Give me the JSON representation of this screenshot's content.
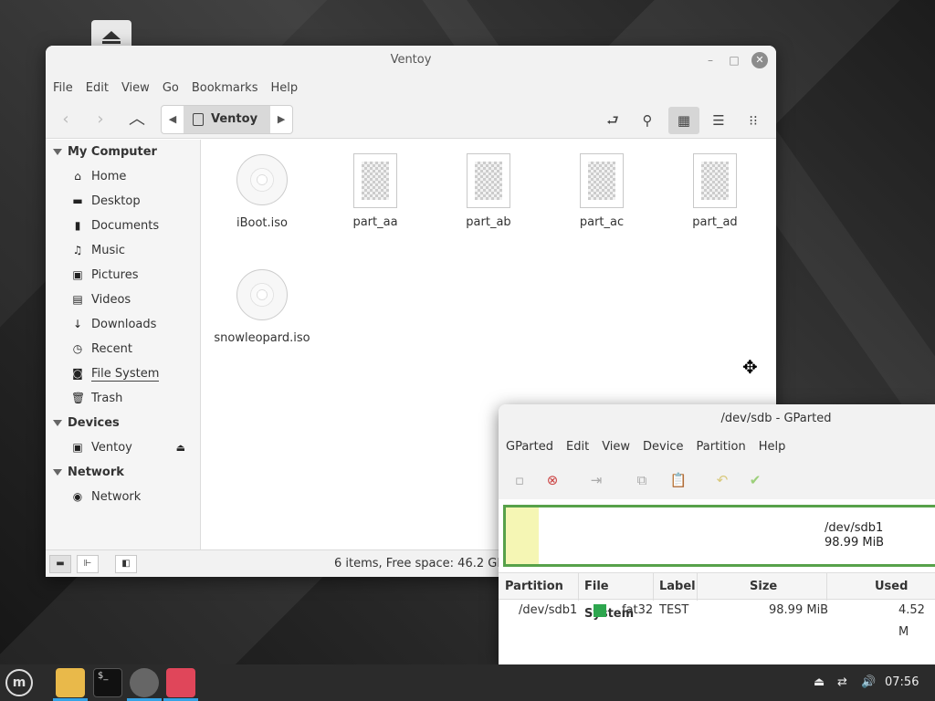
{
  "nemo": {
    "title": "Ventoy",
    "menu": [
      "File",
      "Edit",
      "View",
      "Go",
      "Bookmarks",
      "Help"
    ],
    "path_crumb": "Ventoy",
    "sidebar": {
      "sections": [
        {
          "title": "My Computer",
          "items": [
            {
              "label": "Home",
              "icon": "home-icon"
            },
            {
              "label": "Desktop",
              "icon": "desktop-icon"
            },
            {
              "label": "Documents",
              "icon": "documents-icon"
            },
            {
              "label": "Music",
              "icon": "music-icon"
            },
            {
              "label": "Pictures",
              "icon": "pictures-icon"
            },
            {
              "label": "Videos",
              "icon": "videos-icon"
            },
            {
              "label": "Downloads",
              "icon": "downloads-icon"
            },
            {
              "label": "Recent",
              "icon": "recent-icon"
            },
            {
              "label": "File System",
              "icon": "filesystem-icon"
            },
            {
              "label": "Trash",
              "icon": "trash-icon"
            }
          ]
        },
        {
          "title": "Devices",
          "items": [
            {
              "label": "Ventoy",
              "icon": "drive-icon"
            }
          ]
        },
        {
          "title": "Network",
          "items": [
            {
              "label": "Network",
              "icon": "network-icon"
            }
          ]
        }
      ]
    },
    "files": [
      {
        "name": "iBoot.iso",
        "type": "disc"
      },
      {
        "name": "part_aa",
        "type": "doc"
      },
      {
        "name": "part_ab",
        "type": "doc"
      },
      {
        "name": "part_ac",
        "type": "doc"
      },
      {
        "name": "part_ad",
        "type": "doc"
      },
      {
        "name": "snowleopard.iso",
        "type": "disc"
      }
    ],
    "status": "6 items, Free space: 46.2 GB"
  },
  "gparted": {
    "title": "/dev/sdb - GParted",
    "menu": [
      "GParted",
      "Edit",
      "View",
      "Device",
      "Partition",
      "Help"
    ],
    "disk_label": "/dev/sdb1",
    "disk_size": "98.99 MiB",
    "columns": [
      "Partition",
      "File System",
      "Label",
      "Size",
      "Used"
    ],
    "rows": [
      {
        "partition": "/dev/sdb1",
        "fs": "fat32",
        "fs_color": "#2da64e",
        "label": "TEST",
        "size": "98.99 MiB",
        "used": "4.52 M"
      }
    ]
  },
  "taskbar": {
    "clock": "07:56"
  }
}
